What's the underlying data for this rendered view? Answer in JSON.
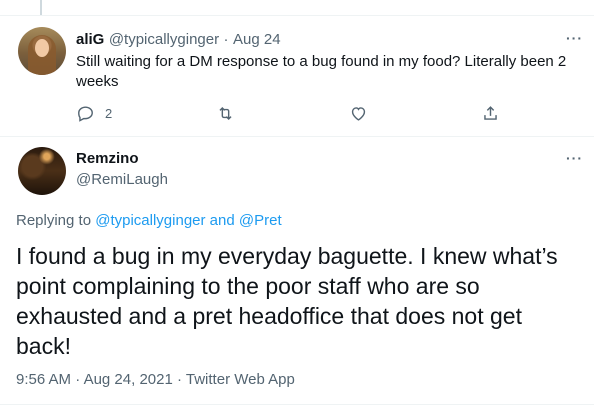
{
  "tweet1": {
    "display_name": "aliG",
    "handle": "@typicallyginger",
    "separator": "·",
    "date": "Aug 24",
    "text": "Still waiting for a DM response to a bug found in my food? Literally been 2 weeks",
    "reply_count": "2",
    "more": "···"
  },
  "tweet2": {
    "display_name": "Remzino",
    "handle": "@RemiLaugh",
    "more": "···",
    "replying_prefix": "Replying to",
    "replying_to_1": "@typicallyginger",
    "replying_and": "and",
    "replying_to_2": "@Pret",
    "text": "I found a bug in my everyday baguette. I knew what’s point complaining to the poor staff who are so exhausted and a pret headoffice that does not get back!",
    "time": "9:56 AM",
    "separator": "·",
    "date": "Aug 24, 2021",
    "source": "Twitter Web App"
  },
  "icons": [
    "reply-icon",
    "retweet-icon",
    "like-icon",
    "share-icon",
    "more-icon"
  ],
  "colors": {
    "link": "#1d9bf0",
    "secondary_text": "#536471",
    "primary_text": "#0f1419"
  }
}
